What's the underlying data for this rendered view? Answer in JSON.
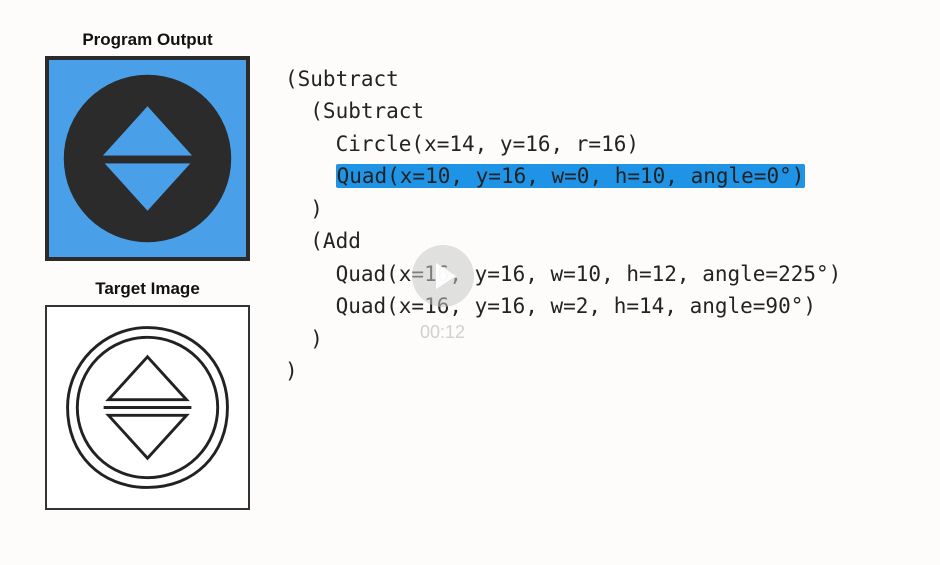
{
  "labels": {
    "program_output": "Program Output",
    "target_image": "Target Image"
  },
  "code": {
    "line1": "(Subtract",
    "line2": "  (Subtract",
    "line3": "    Circle(x=14, y=16, r=16)",
    "line4_hl": "Quad(x=10, y=16, w=0, h=10, angle=0°)",
    "line4_prefix": "    ",
    "line5": "  )",
    "line6": "  (Add",
    "line7": "    Quad(x=16, y=16, w=10, h=12, angle=225°)",
    "line8": "    Quad(x=16, y=16, w=2, h=14, angle=90°)",
    "line9": "  )",
    "line10": ")"
  },
  "video": {
    "timestamp": "00:12"
  },
  "colors": {
    "highlight": "#1f93e5",
    "output_bg": "#4aa0e8",
    "output_shape": "#2b2b2b",
    "output_diamond": "#4aa0e8"
  },
  "chart_data": {
    "type": "other",
    "program": {
      "op": "Subtract",
      "children": [
        {
          "op": "Subtract",
          "children": [
            {
              "shape": "Circle",
              "x": 14,
              "y": 16,
              "r": 16
            },
            {
              "shape": "Quad",
              "x": 10,
              "y": 16,
              "w": 0,
              "h": 10,
              "angle": 0
            }
          ]
        },
        {
          "op": "Add",
          "children": [
            {
              "shape": "Quad",
              "x": 16,
              "y": 16,
              "w": 10,
              "h": 12,
              "angle": 225
            },
            {
              "shape": "Quad",
              "x": 16,
              "y": 16,
              "w": 2,
              "h": 14,
              "angle": 90
            }
          ]
        }
      ]
    }
  }
}
